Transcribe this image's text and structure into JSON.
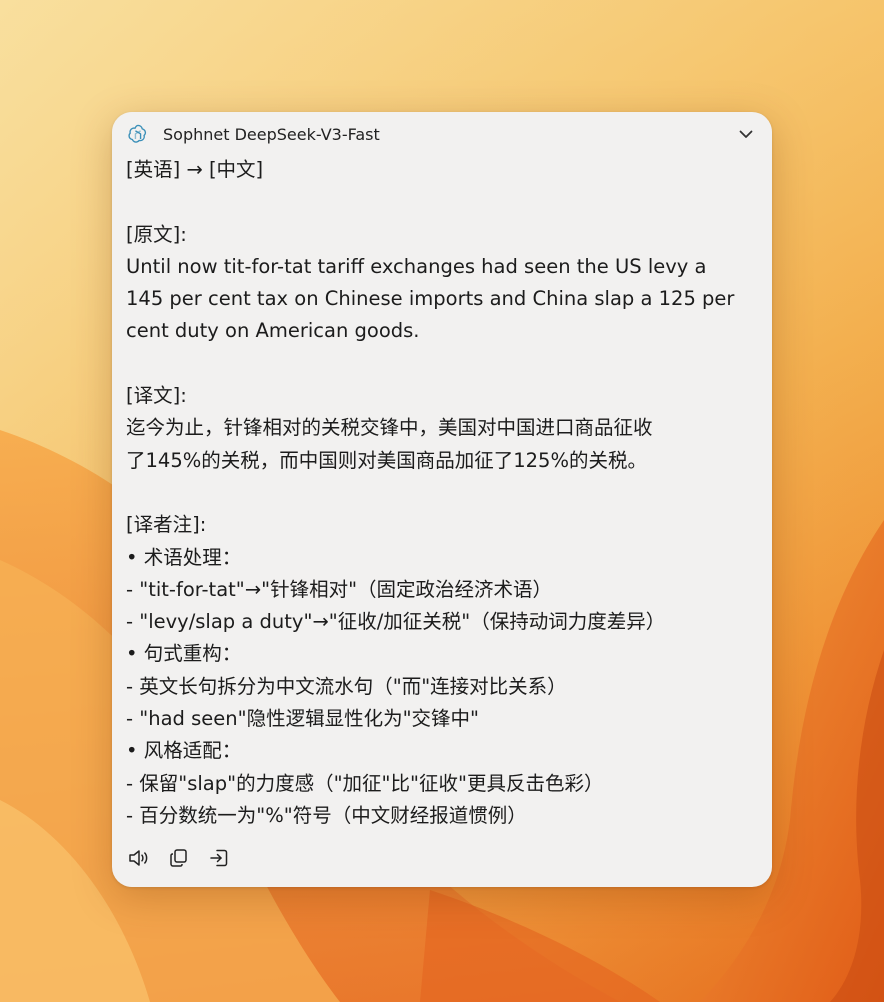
{
  "window": {
    "title": "Sophnet DeepSeek-V3-Fast"
  },
  "header": {
    "logo_icon": "openai-logo-icon",
    "collapse_icon": "chevron-down-icon"
  },
  "content": {
    "direction": "[英语] → [中文]",
    "source_heading": "[原文]:",
    "source_lines": [
      "Until now tit-for-tat tariff exchanges had seen the US levy a",
      "145 per cent tax on Chinese imports and China slap a 125 per",
      "cent duty on American goods."
    ],
    "translation_heading": "[译文]:",
    "translation_lines": [
      "迄今为止，针锋相对的关税交锋中，美国对中国进口商品征收",
      "了145%的关税，而中国则对美国商品加征了125%的关税。"
    ],
    "notes_heading": "[译者注]:",
    "notes": [
      {
        "title": "• 术语处理：",
        "items": [
          "- \"tit-for-tat\"→\"针锋相对\"（固定政治经济术语）",
          "- \"levy/slap a duty\"→\"征收/加征关税\"（保持动词力度差异）"
        ]
      },
      {
        "title": "• 句式重构：",
        "items": [
          "- 英文长句拆分为中文流水句（\"而\"连接对比关系）",
          "- \"had seen\"隐性逻辑显性化为\"交锋中\""
        ]
      },
      {
        "title": "• 风格适配：",
        "items": [
          "- 保留\"slap\"的力度感（\"加征\"比\"征收\"更具反击色彩）",
          "- 百分数统一为\"%\"符号（中文财经报道惯例）"
        ]
      }
    ]
  },
  "toolbar": {
    "icons": [
      "speaker-icon",
      "copy-icon",
      "insert-icon"
    ]
  }
}
